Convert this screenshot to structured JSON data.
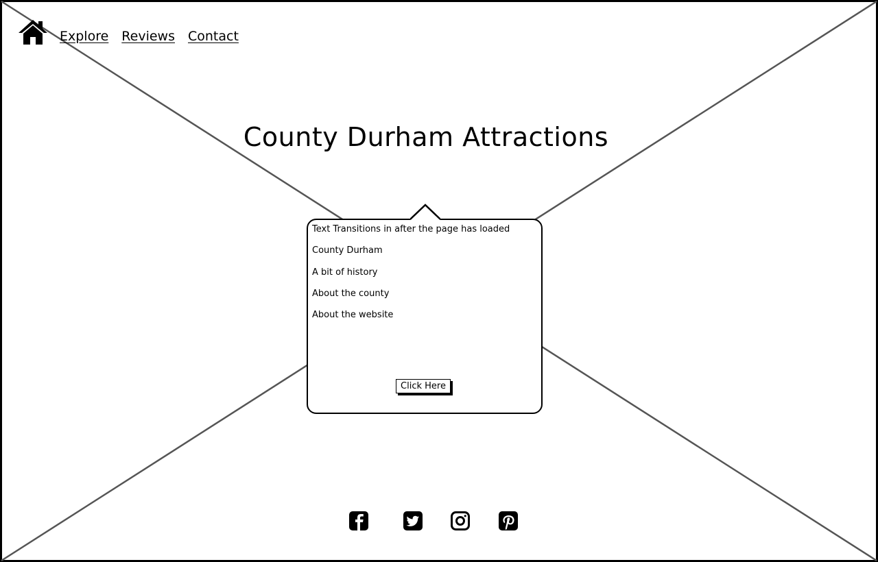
{
  "nav": {
    "home_icon": "home-icon",
    "links": [
      "Explore",
      "Reviews",
      "Contact"
    ]
  },
  "page": {
    "title": "County Durham Attractions"
  },
  "popover": {
    "lines": [
      "Text Transitions in after the page has loaded",
      "County Durham",
      "A bit of history",
      "About the county",
      "About the website"
    ],
    "button_label": "Click Here"
  },
  "social": {
    "icons": [
      "facebook-icon",
      "twitter-icon",
      "instagram-icon",
      "pinterest-icon"
    ]
  },
  "colors": {
    "ink": "#000000",
    "placeholder_lines": "#555555",
    "background": "#ffffff"
  }
}
